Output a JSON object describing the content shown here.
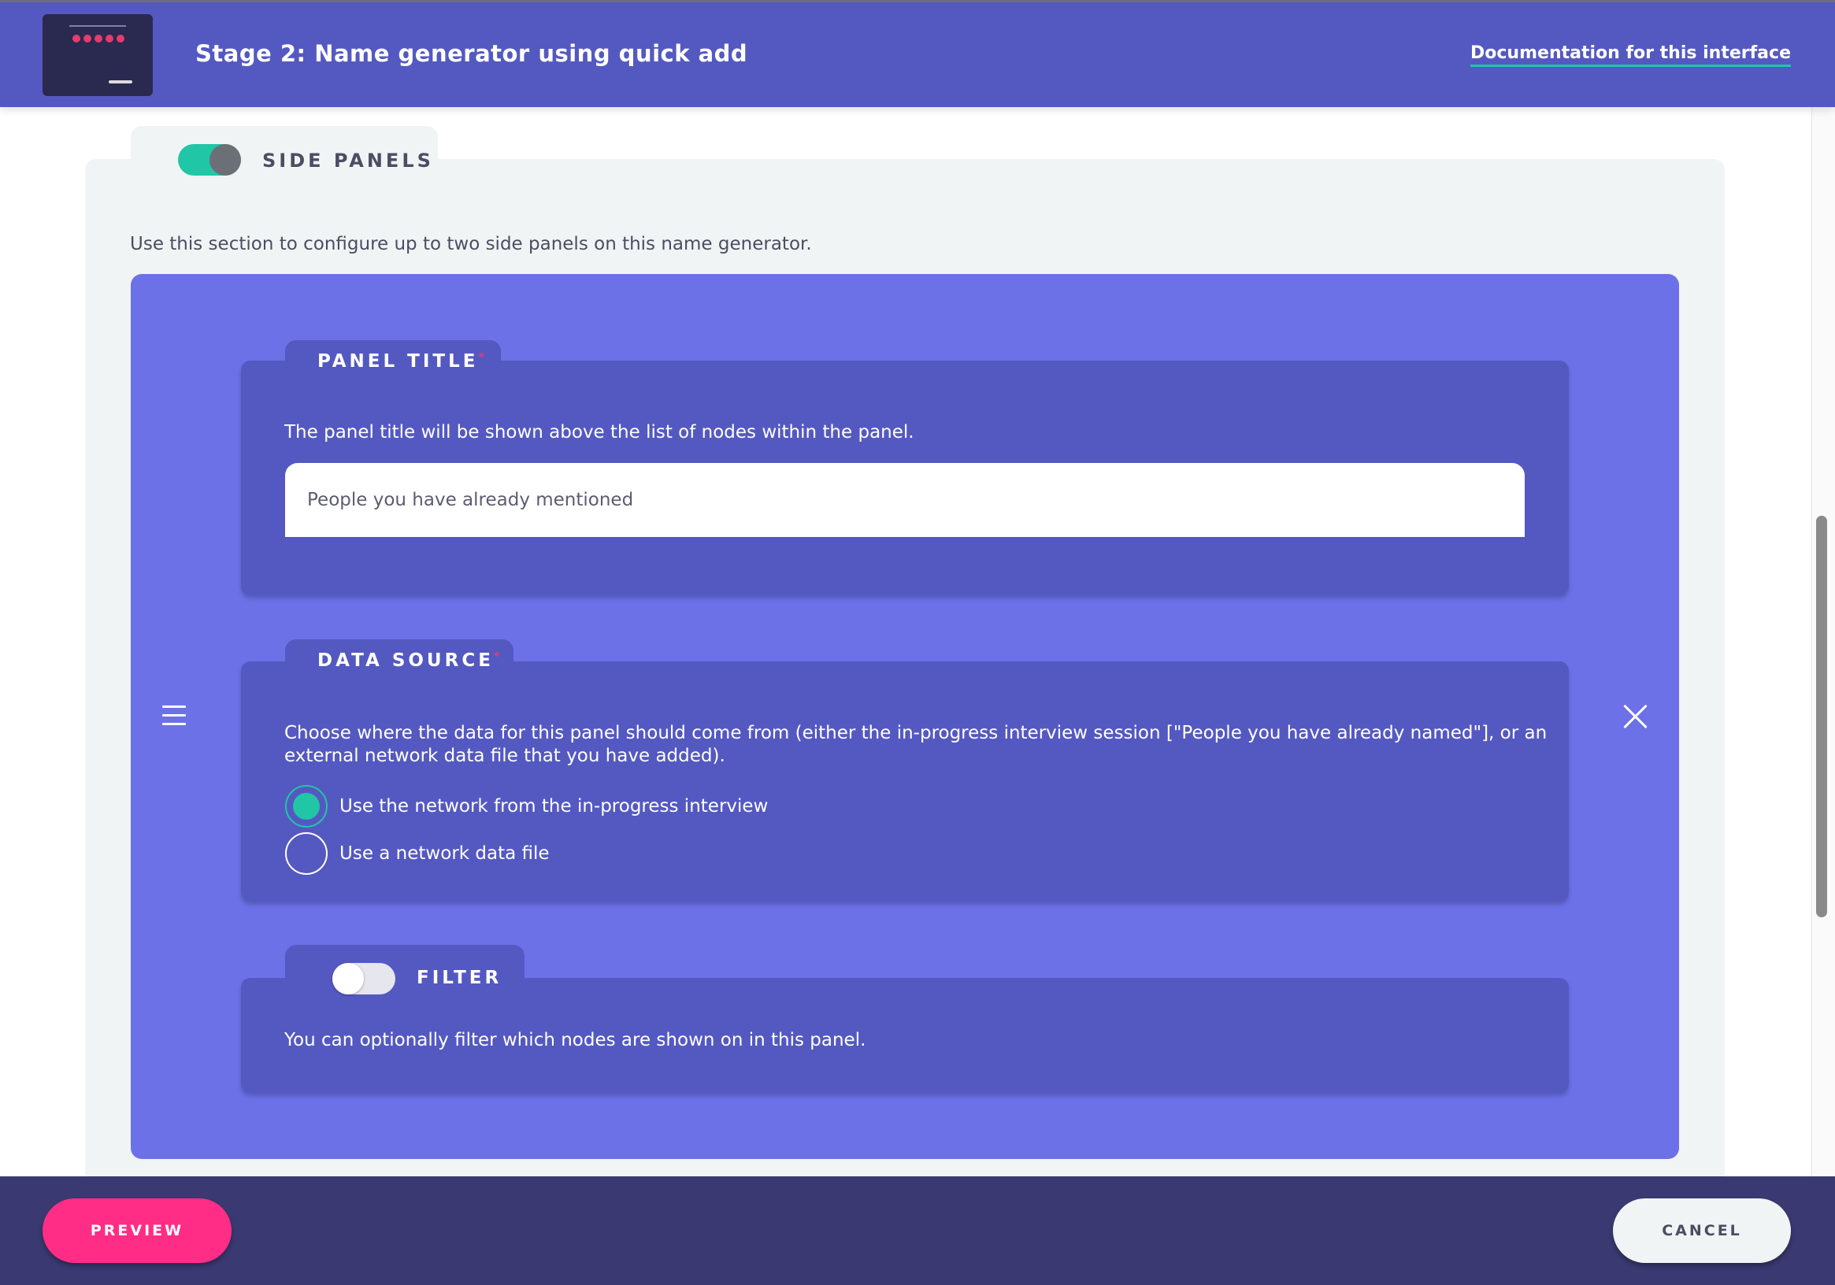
{
  "header": {
    "title": "Stage 2: Name generator using quick add",
    "doc_link": "Documentation for this interface"
  },
  "side_panels": {
    "label": "SIDE PANELS",
    "enabled": true,
    "description": "Use this section to configure up to two side panels on this name generator."
  },
  "panel_title": {
    "label": "PANEL TITLE",
    "required_marker": "*",
    "description": "The panel title will be shown above the list of nodes within the panel.",
    "value": "People you have already mentioned"
  },
  "data_source": {
    "label": "DATA SOURCE",
    "required_marker": "*",
    "description_line1": "Choose where the data for this panel should come from (either the in-progress interview session [\"People you have already named\"], or an",
    "description_line2": "external network data file that you have added).",
    "options": [
      {
        "label": "Use the network from the in-progress interview",
        "checked": true
      },
      {
        "label": "Use a network data file",
        "checked": false
      }
    ]
  },
  "filter": {
    "label": "FILTER",
    "enabled": false,
    "description": "You can optionally filter which nodes are shown on in this panel."
  },
  "footer": {
    "preview_label": "PREVIEW",
    "cancel_label": "CANCEL"
  },
  "colors": {
    "header_bg": "#5459c1",
    "panel_bg": "#6c71e8",
    "accent_green": "#20c6a6",
    "preview_pink": "#ff2d86",
    "footer_bg": "#3a3971"
  },
  "icons": [
    "drag-handle-icon",
    "close-icon",
    "stage-thumbnail"
  ]
}
